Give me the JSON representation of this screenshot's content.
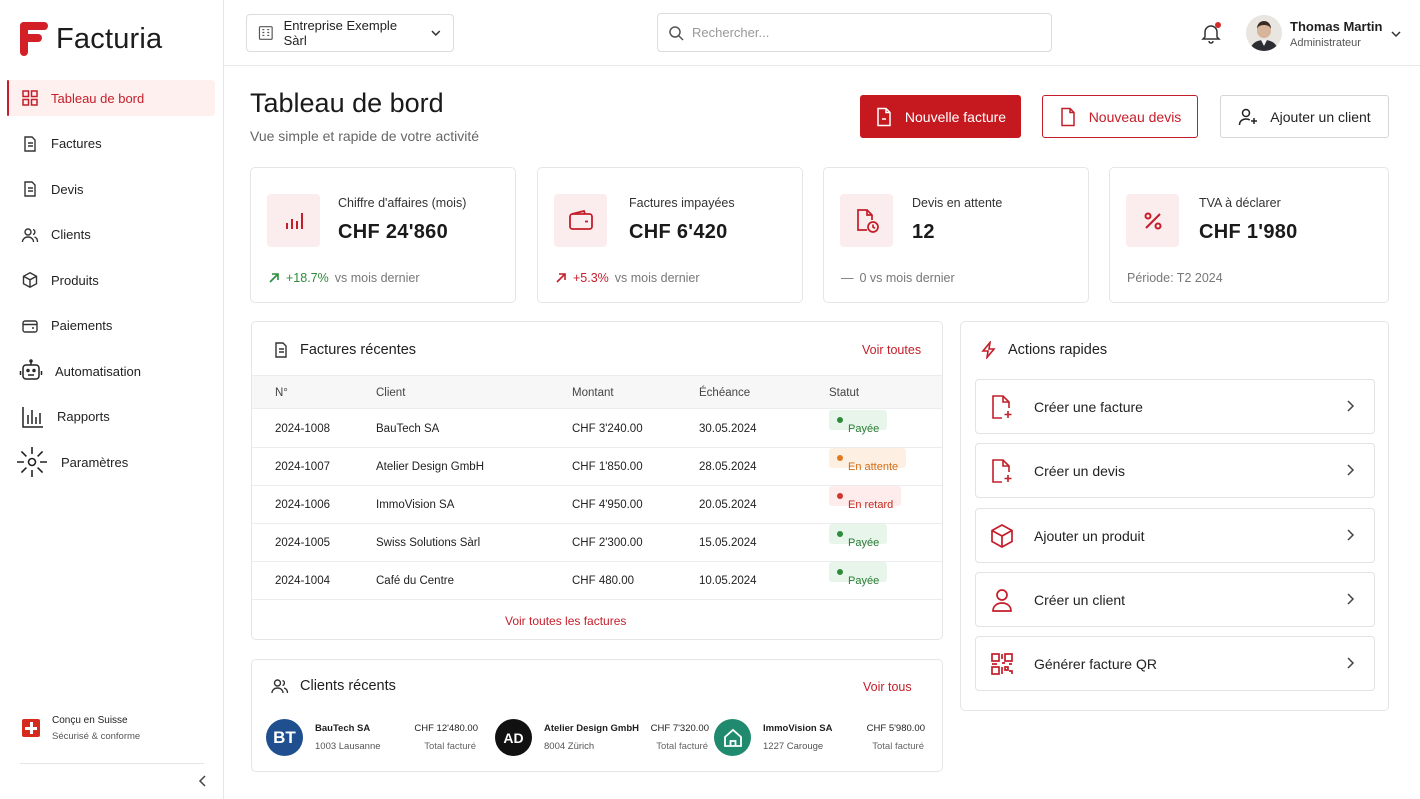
{
  "app": {
    "name": "Facturia"
  },
  "sidebar": {
    "items": [
      {
        "label": "Tableau de bord",
        "icon": "grid-icon",
        "active": true
      },
      {
        "label": "Factures",
        "icon": "document-icon"
      },
      {
        "label": "Devis",
        "icon": "document-icon"
      },
      {
        "label": "Clients",
        "icon": "users-icon"
      },
      {
        "label": "Produits",
        "icon": "box-icon"
      },
      {
        "label": "Paiements",
        "icon": "wallet-icon"
      },
      {
        "label": "Automatisation",
        "icon": "robot-icon"
      },
      {
        "label": "Rapports",
        "icon": "bar-chart-icon"
      },
      {
        "label": "Paramètres",
        "icon": "gear-icon"
      }
    ],
    "footer": {
      "line1": "Conçu en Suisse",
      "line2": "Sécurisé & conforme"
    }
  },
  "topbar": {
    "company": "Entreprise Exemple Sàrl",
    "search_placeholder": "Rechercher...",
    "user": {
      "name": "Thomas Martin",
      "role": "Administrateur"
    }
  },
  "header": {
    "title": "Tableau de bord",
    "subtitle": "Vue simple et rapide de votre activité",
    "btn_new_invoice": "Nouvelle facture",
    "btn_new_quote": "Nouveau devis",
    "btn_add_client": "Ajouter un client"
  },
  "stats": [
    {
      "label": "Chiffre d'affaires (mois)",
      "value": "CHF 24'860",
      "delta": "+18.7%",
      "foot": "vs mois dernier",
      "icon": "bar-chart-icon"
    },
    {
      "label": "Factures impayées",
      "value": "CHF 6'420",
      "delta": "+5.3%",
      "foot": "vs mois dernier",
      "icon": "wallet-icon"
    },
    {
      "label": "Devis en attente",
      "value": "12",
      "delta": "—",
      "foot": "0 vs mois dernier",
      "icon": "document-clock-icon"
    },
    {
      "label": "TVA à déclarer",
      "value": "CHF 1'980",
      "foot": "Période: T2 2024",
      "icon": "percent-icon"
    }
  ],
  "recent_invoices": {
    "title": "Factures récentes",
    "link": "Voir toutes",
    "columns": [
      "N°",
      "Client",
      "Montant",
      "Échéance",
      "Statut"
    ],
    "rows": [
      {
        "num": "2024-1008",
        "client": "BauTech SA",
        "amount": "CHF 3'240.00",
        "due": "30.05.2024",
        "status": "Payée",
        "kind": "paid"
      },
      {
        "num": "2024-1007",
        "client": "Atelier Design GmbH",
        "amount": "CHF 1'850.00",
        "due": "28.05.2024",
        "status": "En attente",
        "kind": "wait"
      },
      {
        "num": "2024-1006",
        "client": "ImmoVision SA",
        "amount": "CHF 4'950.00",
        "due": "20.05.2024",
        "status": "En retard",
        "kind": "late"
      },
      {
        "num": "2024-1005",
        "client": "Swiss Solutions Sàrl",
        "amount": "CHF 2'300.00",
        "due": "15.05.2024",
        "status": "Payée",
        "kind": "paid"
      },
      {
        "num": "2024-1004",
        "client": "Café du Centre",
        "amount": "CHF 480.00",
        "due": "10.05.2024",
        "status": "Payée",
        "kind": "paid"
      }
    ],
    "footer_link": "Voir toutes les factures"
  },
  "quick_actions": {
    "title": "Actions rapides",
    "items": [
      {
        "label": "Créer une facture",
        "icon": "file-plus-icon"
      },
      {
        "label": "Créer un devis",
        "icon": "file-plus-icon"
      },
      {
        "label": "Ajouter un produit",
        "icon": "box-icon"
      },
      {
        "label": "Créer un client",
        "icon": "user-icon"
      },
      {
        "label": "Générer facture QR",
        "icon": "qr-code-icon"
      }
    ]
  },
  "recent_clients": {
    "title": "Clients récents",
    "link": "Voir tous",
    "items": [
      {
        "initials": "BT",
        "name": "BauTech SA",
        "city": "1003 Lausanne",
        "amount": "CHF 12'480.00",
        "amount_label": "Total facturé",
        "color": "#1f4f8f"
      },
      {
        "initials": "AD",
        "name": "Atelier Design GmbH",
        "city": "8004 Zürich",
        "amount": "CHF 7'320.00",
        "amount_label": "Total facturé",
        "color": "#111111"
      },
      {
        "initials": "",
        "name": "ImmoVision SA",
        "city": "1227 Carouge",
        "amount": "CHF 5'980.00",
        "amount_label": "Total facturé",
        "color": "#1f8a6e"
      }
    ]
  },
  "colors": {
    "accent": "#c5191f",
    "accent_soft": "#fbeced",
    "success": "#2e8b3c",
    "warning": "#e37a1d",
    "danger": "#d1342a"
  }
}
